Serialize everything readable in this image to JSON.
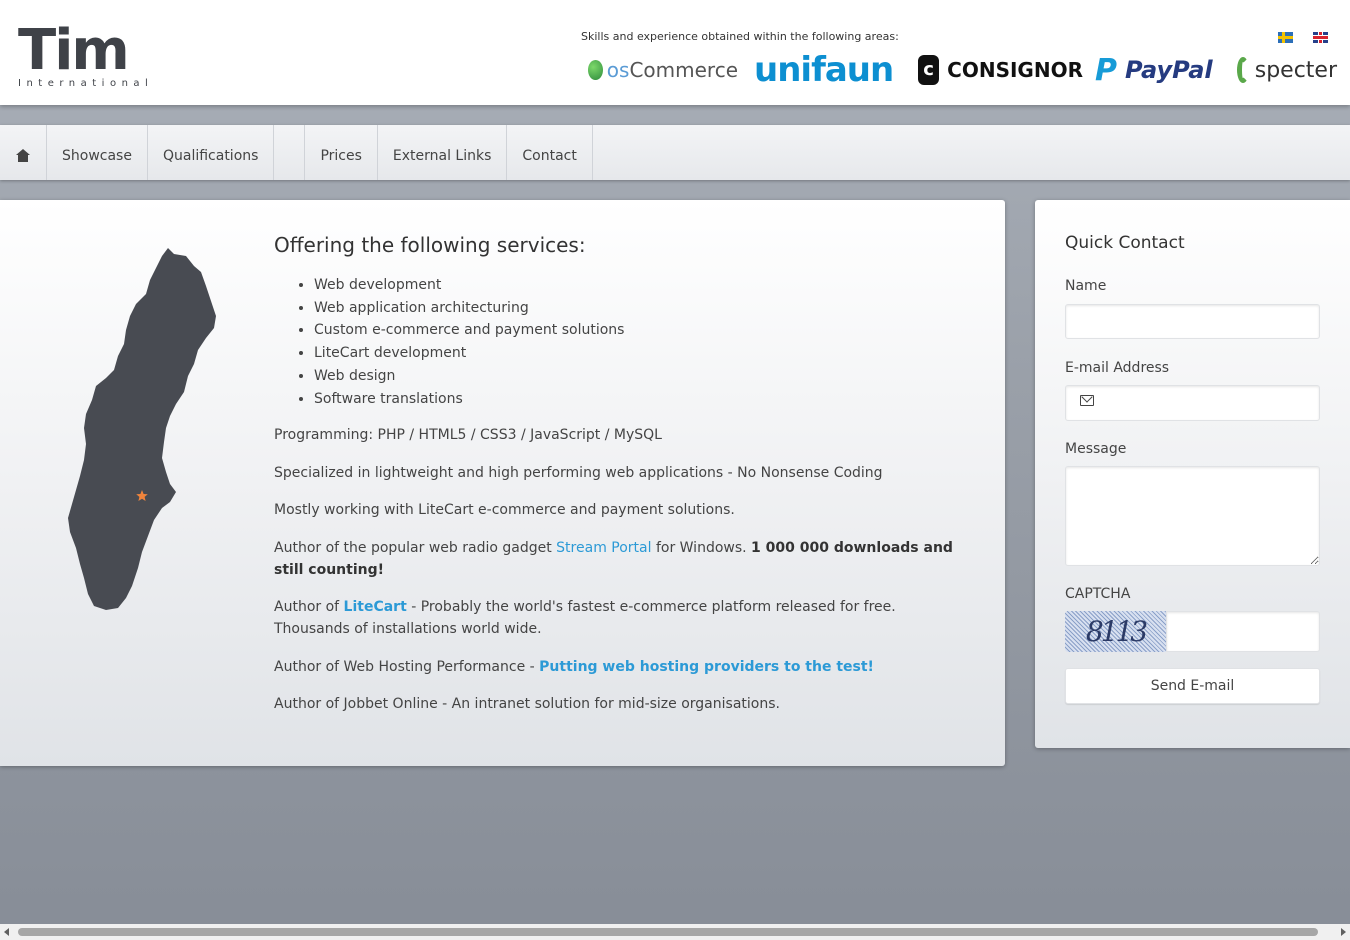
{
  "header": {
    "logo_mark": "Tim",
    "logo_sub": "International",
    "skills_caption": "Skills and experience obtained within the following areas:",
    "brands": {
      "oscommerce_prefix": "os",
      "oscommerce": "Commerce",
      "unifaun": "unifaun",
      "consignor": "CONSIGNOR",
      "paypal": "PayPal",
      "specter": "specter"
    },
    "flags": [
      {
        "icon": "swedish-flag-icon"
      },
      {
        "icon": "british-flag-icon"
      }
    ]
  },
  "nav": {
    "home_icon": "home-icon",
    "items": [
      {
        "label": "Showcase"
      },
      {
        "label": "Qualifications"
      },
      {
        "label": ""
      },
      {
        "label": "Prices"
      },
      {
        "label": "External Links"
      },
      {
        "label": "Contact"
      }
    ]
  },
  "main": {
    "map_icon": "sweden-map-icon",
    "heading": "Offering the following services:",
    "services": [
      "Web development",
      "Web application architecturing",
      "Custom e-commerce and payment solutions",
      "LiteCart development",
      "Web design",
      "Software translations"
    ],
    "programming": "Programming: PHP / HTML5 / CSS3 / JavaScript / MySQL",
    "specialized": "Specialized in lightweight and high performing web applications - No Nonsense Coding",
    "mostly": "Mostly working with LiteCart e-commerce and payment solutions.",
    "author1_pre": "Author of the popular web radio gadget ",
    "author1_link": "Stream Portal",
    "author1_mid": " for Windows. ",
    "author1_strong": "1 000 000 downloads and still counting!",
    "author2_pre": "Author of ",
    "author2_link": "LiteCart",
    "author2_post": " - Probably the world's fastest e-commerce platform released for free. Thousands of installations world wide.",
    "author3_pre": "Author of Web Hosting Performance - ",
    "author3_link": "Putting web hosting providers to the test!",
    "author4": "Author of Jobbet Online - An intranet solution for mid-size organisations."
  },
  "quick_contact": {
    "title": "Quick Contact",
    "name_label": "Name",
    "name_value": "",
    "email_label": "E-mail Address",
    "email_value": "",
    "message_label": "Message",
    "message_value": "",
    "captcha_label": "CAPTCHA",
    "captcha_text": "8113",
    "captcha_value": "",
    "send_label": "Send E-mail"
  },
  "colors": {
    "link": "#2c9ad6",
    "accent_star": "#f0843c"
  }
}
